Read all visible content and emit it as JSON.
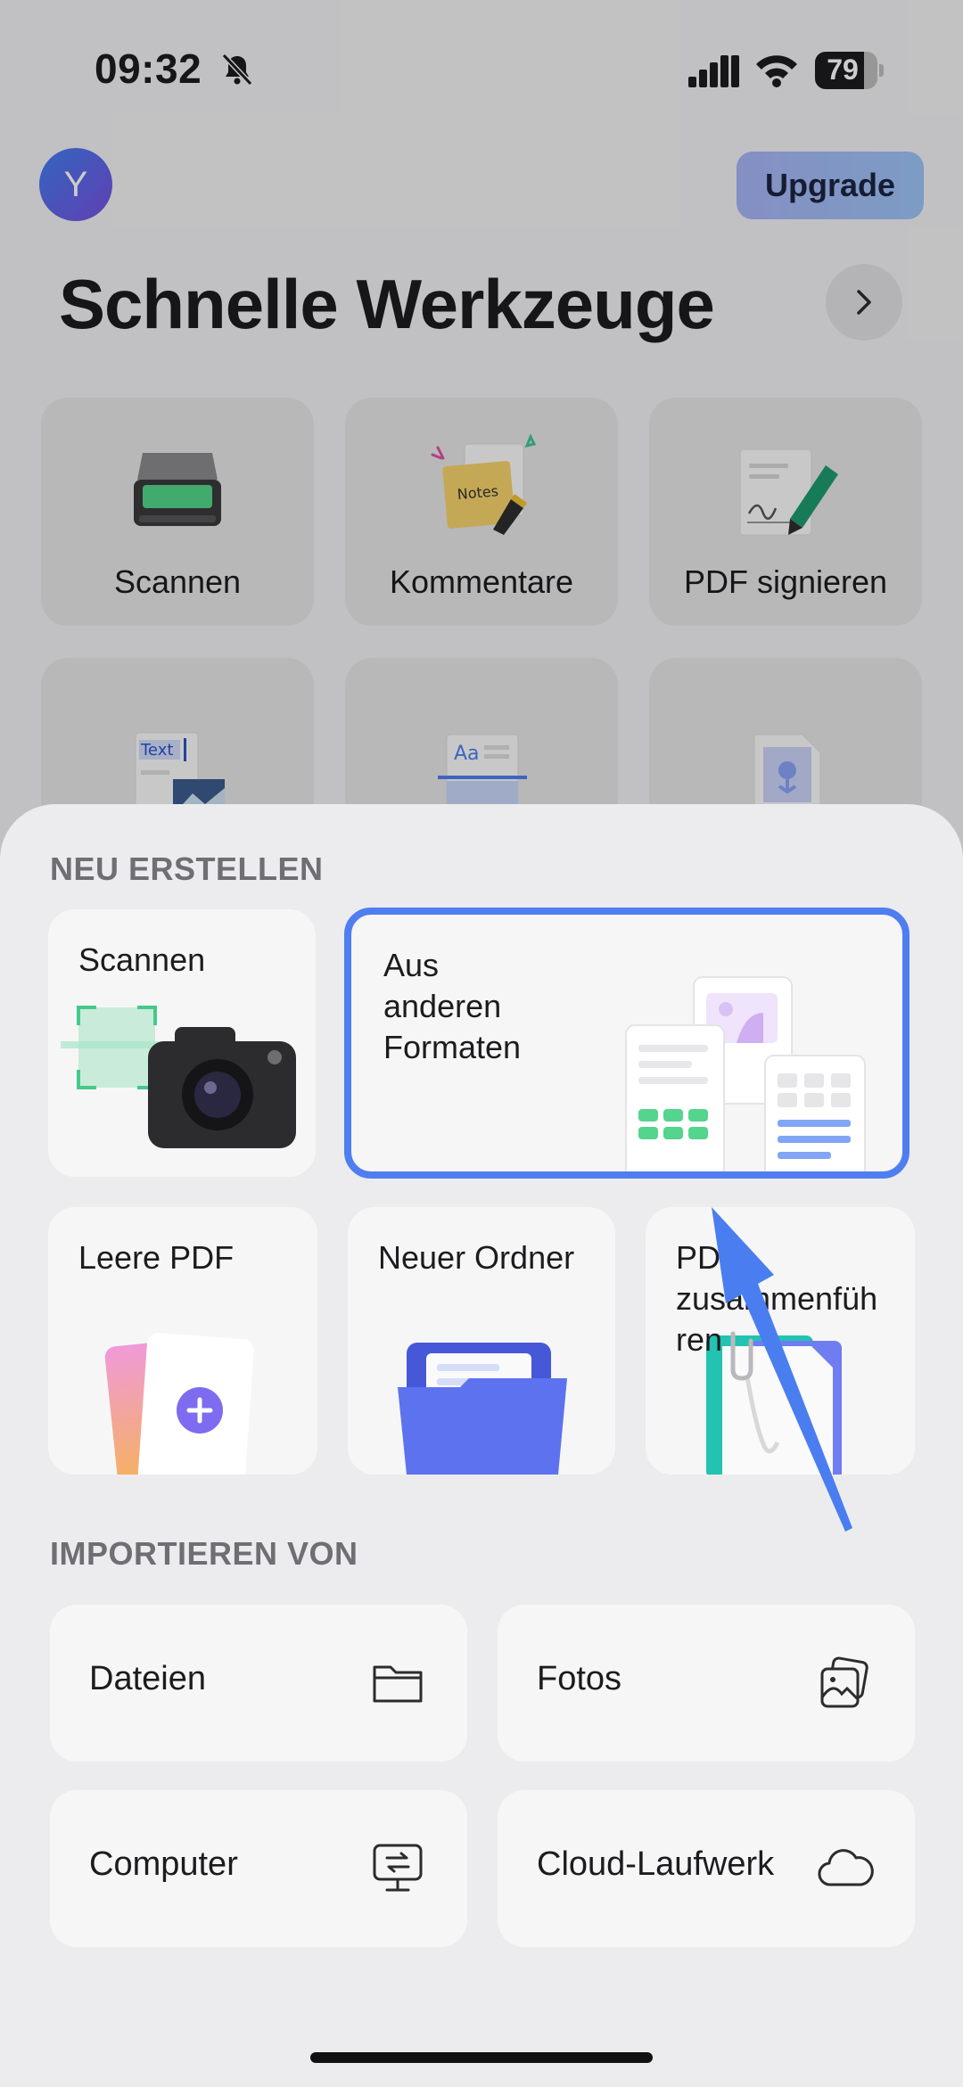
{
  "status": {
    "time": "09:32",
    "battery": "79",
    "battery_level": 0.79
  },
  "header": {
    "avatar_initial": "Y",
    "upgrade_label": "Upgrade",
    "title": "Schnelle Werkzeuge"
  },
  "tools": [
    {
      "label": "Scannen"
    },
    {
      "label": "Kommentare"
    },
    {
      "label": "PDF signieren"
    }
  ],
  "tool_illustrations": {
    "text_label": "Text",
    "aa_label": "Aa",
    "notes_label": "Notes"
  },
  "sheet": {
    "new_heading": "NEU ERSTELLEN",
    "scan": "Scannen",
    "from_formats_lines": [
      "Aus",
      "anderen",
      "Formaten"
    ],
    "blank_pdf": "Leere PDF",
    "new_folder": "Neuer Ordner",
    "merge_lines": [
      "PDF",
      "zusammenfüh",
      "ren"
    ],
    "import_heading": "IMPORTIEREN VON",
    "imports": [
      {
        "label": "Dateien",
        "icon": "folder-icon"
      },
      {
        "label": "Fotos",
        "icon": "photos-icon"
      },
      {
        "label": "Computer",
        "icon": "computer-transfer-icon"
      },
      {
        "label": "Cloud-Laufwerk",
        "icon": "cloud-icon"
      }
    ]
  },
  "colors": {
    "accent": "#4f7ef0",
    "pointer": "#4a7ef0",
    "upgrade_gradient": [
      "#a7b3f6",
      "#9cc4f6"
    ]
  }
}
